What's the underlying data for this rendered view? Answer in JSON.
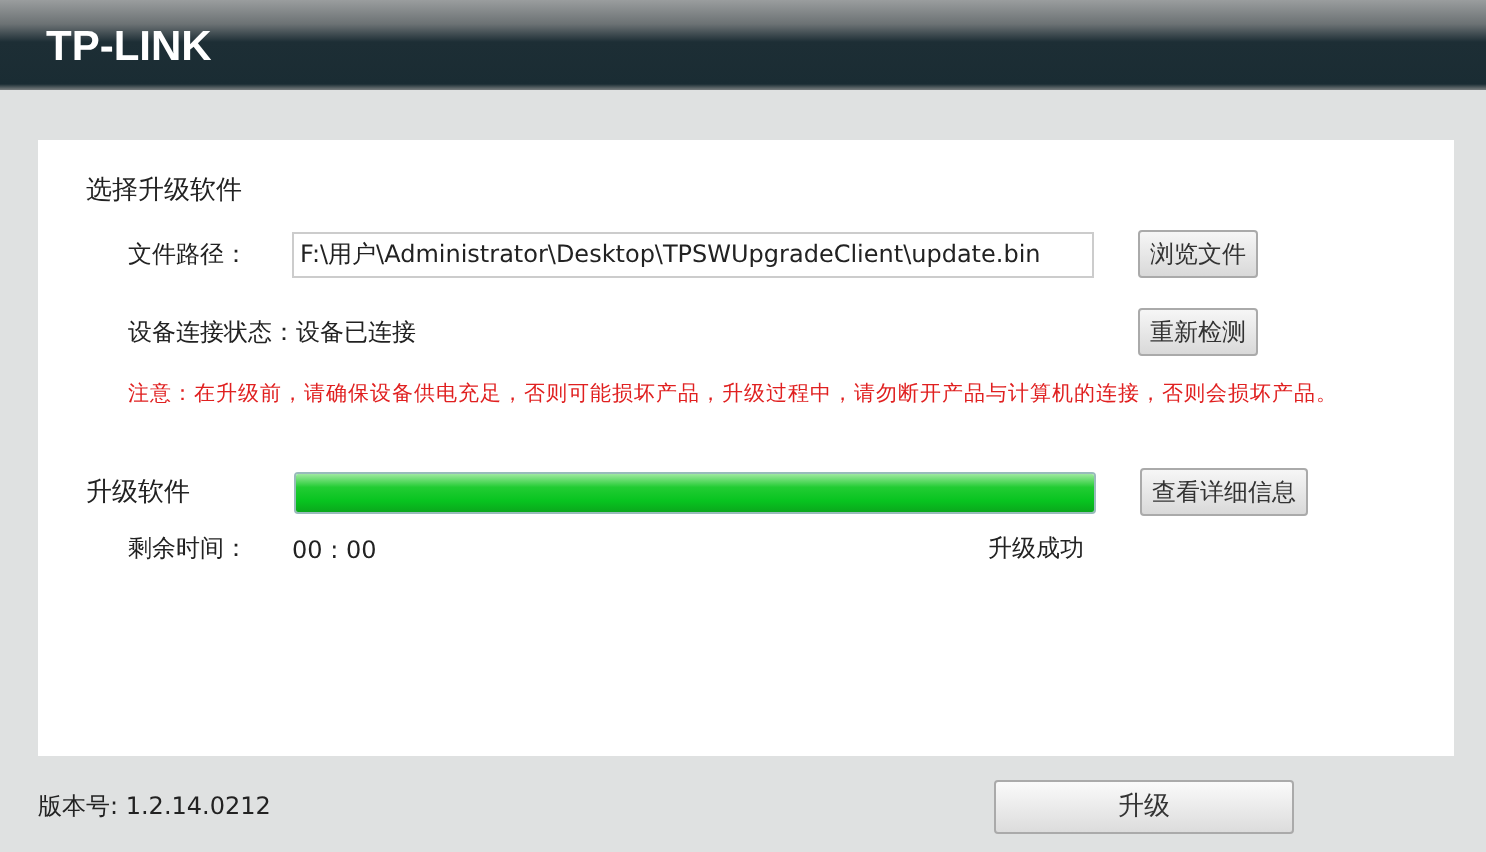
{
  "header": {
    "logo": "TP-LINK"
  },
  "select_section": {
    "title": "选择升级软件",
    "file_path_label": "文件路径：",
    "file_path_value": "F:\\用户\\Administrator\\Desktop\\TPSWUpgradeClient\\update.bin",
    "browse_button": "浏览文件",
    "status_label": "设备连接状态：",
    "status_value": "设备已连接",
    "recheck_button": "重新检测",
    "warning": "注意：在升级前，请确保设备供电充足，否则可能损坏产品，升级过程中，请勿断开产品与计算机的连接，否则会损坏产品。"
  },
  "upgrade_section": {
    "title": "升级软件",
    "progress": {
      "level": 1
    },
    "details_button": "查看详细信息",
    "remaining_label": "剩余时间：",
    "remaining_value": "00 : 00",
    "result": "升级成功"
  },
  "footer": {
    "version": "版本号: 1.2.14.0212",
    "upgrade_button": "升级"
  }
}
